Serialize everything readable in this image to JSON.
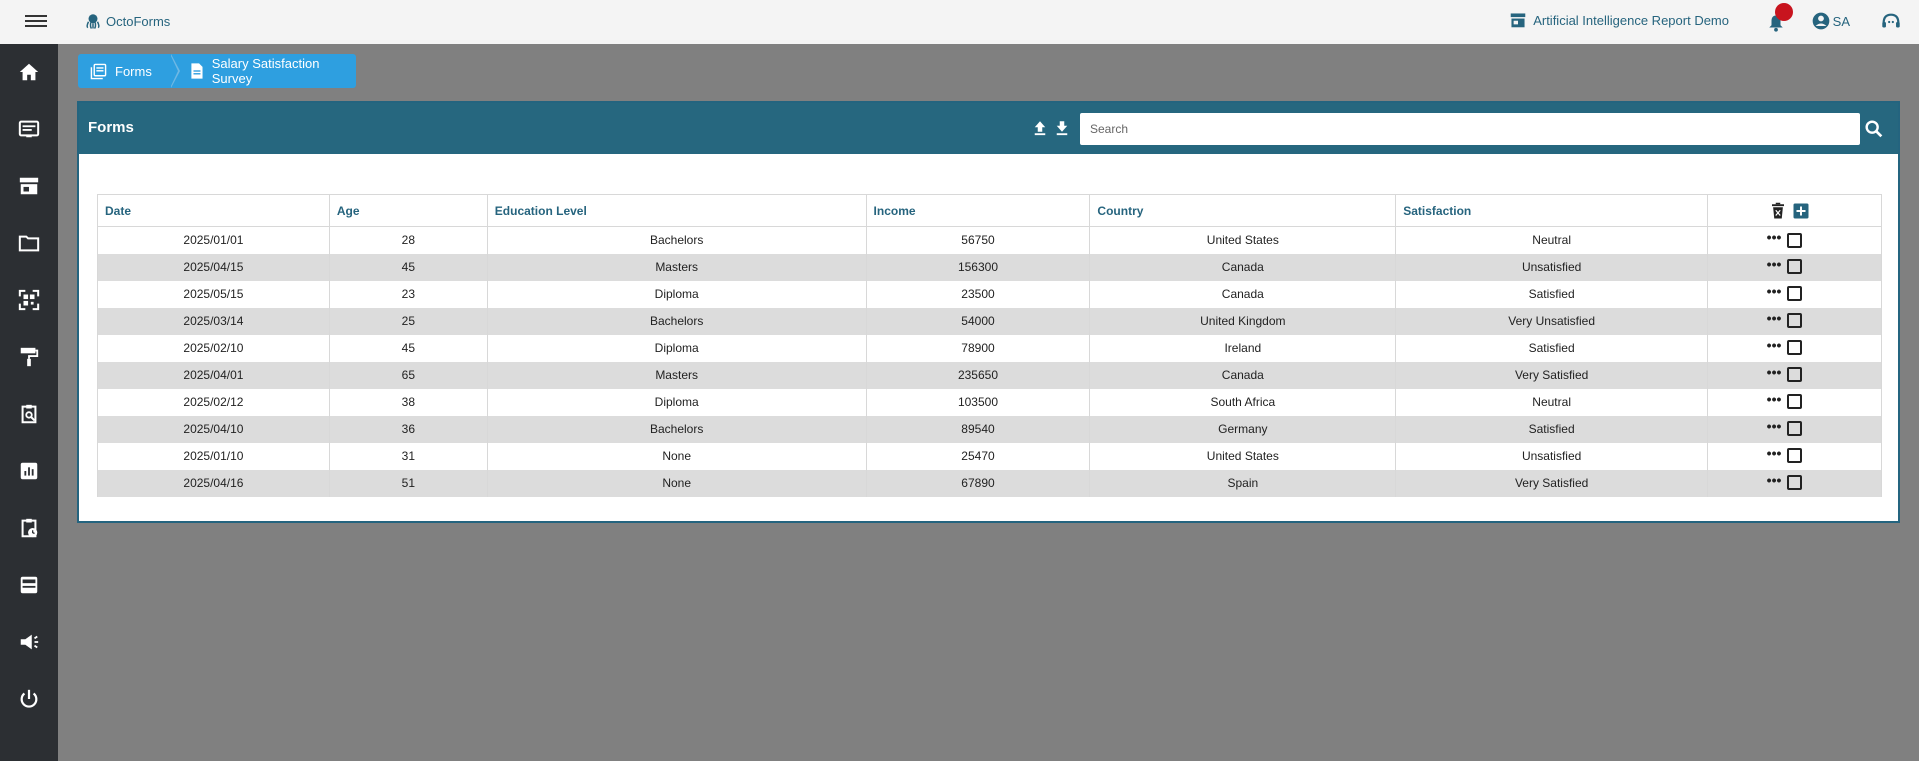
{
  "app": {
    "name": "OctoForms",
    "report_link": "Artificial Intelligence Report Demo",
    "user_initials": "SA"
  },
  "icons": {
    "menu": "hamburger-icon",
    "brand": "octopus-icon",
    "report": "storefront-icon",
    "notifications": "bell-icon",
    "user": "account-circle-icon",
    "support": "support-agent-icon"
  },
  "sidebar": {
    "items": [
      {
        "icon": "home-icon"
      },
      {
        "icon": "forms-icon"
      },
      {
        "icon": "store-icon"
      },
      {
        "icon": "folder-icon"
      },
      {
        "icon": "qr-scan-icon"
      },
      {
        "icon": "paint-roller-icon"
      },
      {
        "icon": "clipboard-search-icon"
      },
      {
        "icon": "report-chart-icon"
      },
      {
        "icon": "clipboard-clock-icon"
      },
      {
        "icon": "inbox-icon"
      },
      {
        "icon": "campaign-icon"
      },
      {
        "icon": "power-icon"
      }
    ]
  },
  "breadcrumb": {
    "items": [
      {
        "label": "Forms"
      },
      {
        "label": "Salary Satisfaction Survey"
      }
    ]
  },
  "panel": {
    "title": "Forms",
    "search_placeholder": "Search",
    "search_value": ""
  },
  "table": {
    "headers": [
      "Date",
      "Age",
      "Education Level",
      "Income",
      "Country",
      "Satisfaction"
    ],
    "rows": [
      [
        "2025/01/01",
        "28",
        "Bachelors",
        "56750",
        "United States",
        "Neutral"
      ],
      [
        "2025/04/15",
        "45",
        "Masters",
        "156300",
        "Canada",
        "Unsatisfied"
      ],
      [
        "2025/05/15",
        "23",
        "Diploma",
        "23500",
        "Canada",
        "Satisfied"
      ],
      [
        "2025/03/14",
        "25",
        "Bachelors",
        "54000",
        "United Kingdom",
        "Very Unsatisfied"
      ],
      [
        "2025/02/10",
        "45",
        "Diploma",
        "78900",
        "Ireland",
        "Satisfied"
      ],
      [
        "2025/04/01",
        "65",
        "Masters",
        "235650",
        "Canada",
        "Very Satisfied"
      ],
      [
        "2025/02/12",
        "38",
        "Diploma",
        "103500",
        "South Africa",
        "Neutral"
      ],
      [
        "2025/04/10",
        "36",
        "Bachelors",
        "89540",
        "Germany",
        "Satisfied"
      ],
      [
        "2025/01/10",
        "31",
        "None",
        "25470",
        "United States",
        "Unsatisfied"
      ],
      [
        "2025/04/16",
        "51",
        "None",
        "67890",
        "Spain",
        "Very Satisfied"
      ]
    ],
    "row_action_symbol": "•••"
  },
  "colors": {
    "accent": "#26677f",
    "breadcrumb": "#2e9fe0",
    "sidebar": "#2c2f33",
    "notification_dot": "#c8141e"
  }
}
